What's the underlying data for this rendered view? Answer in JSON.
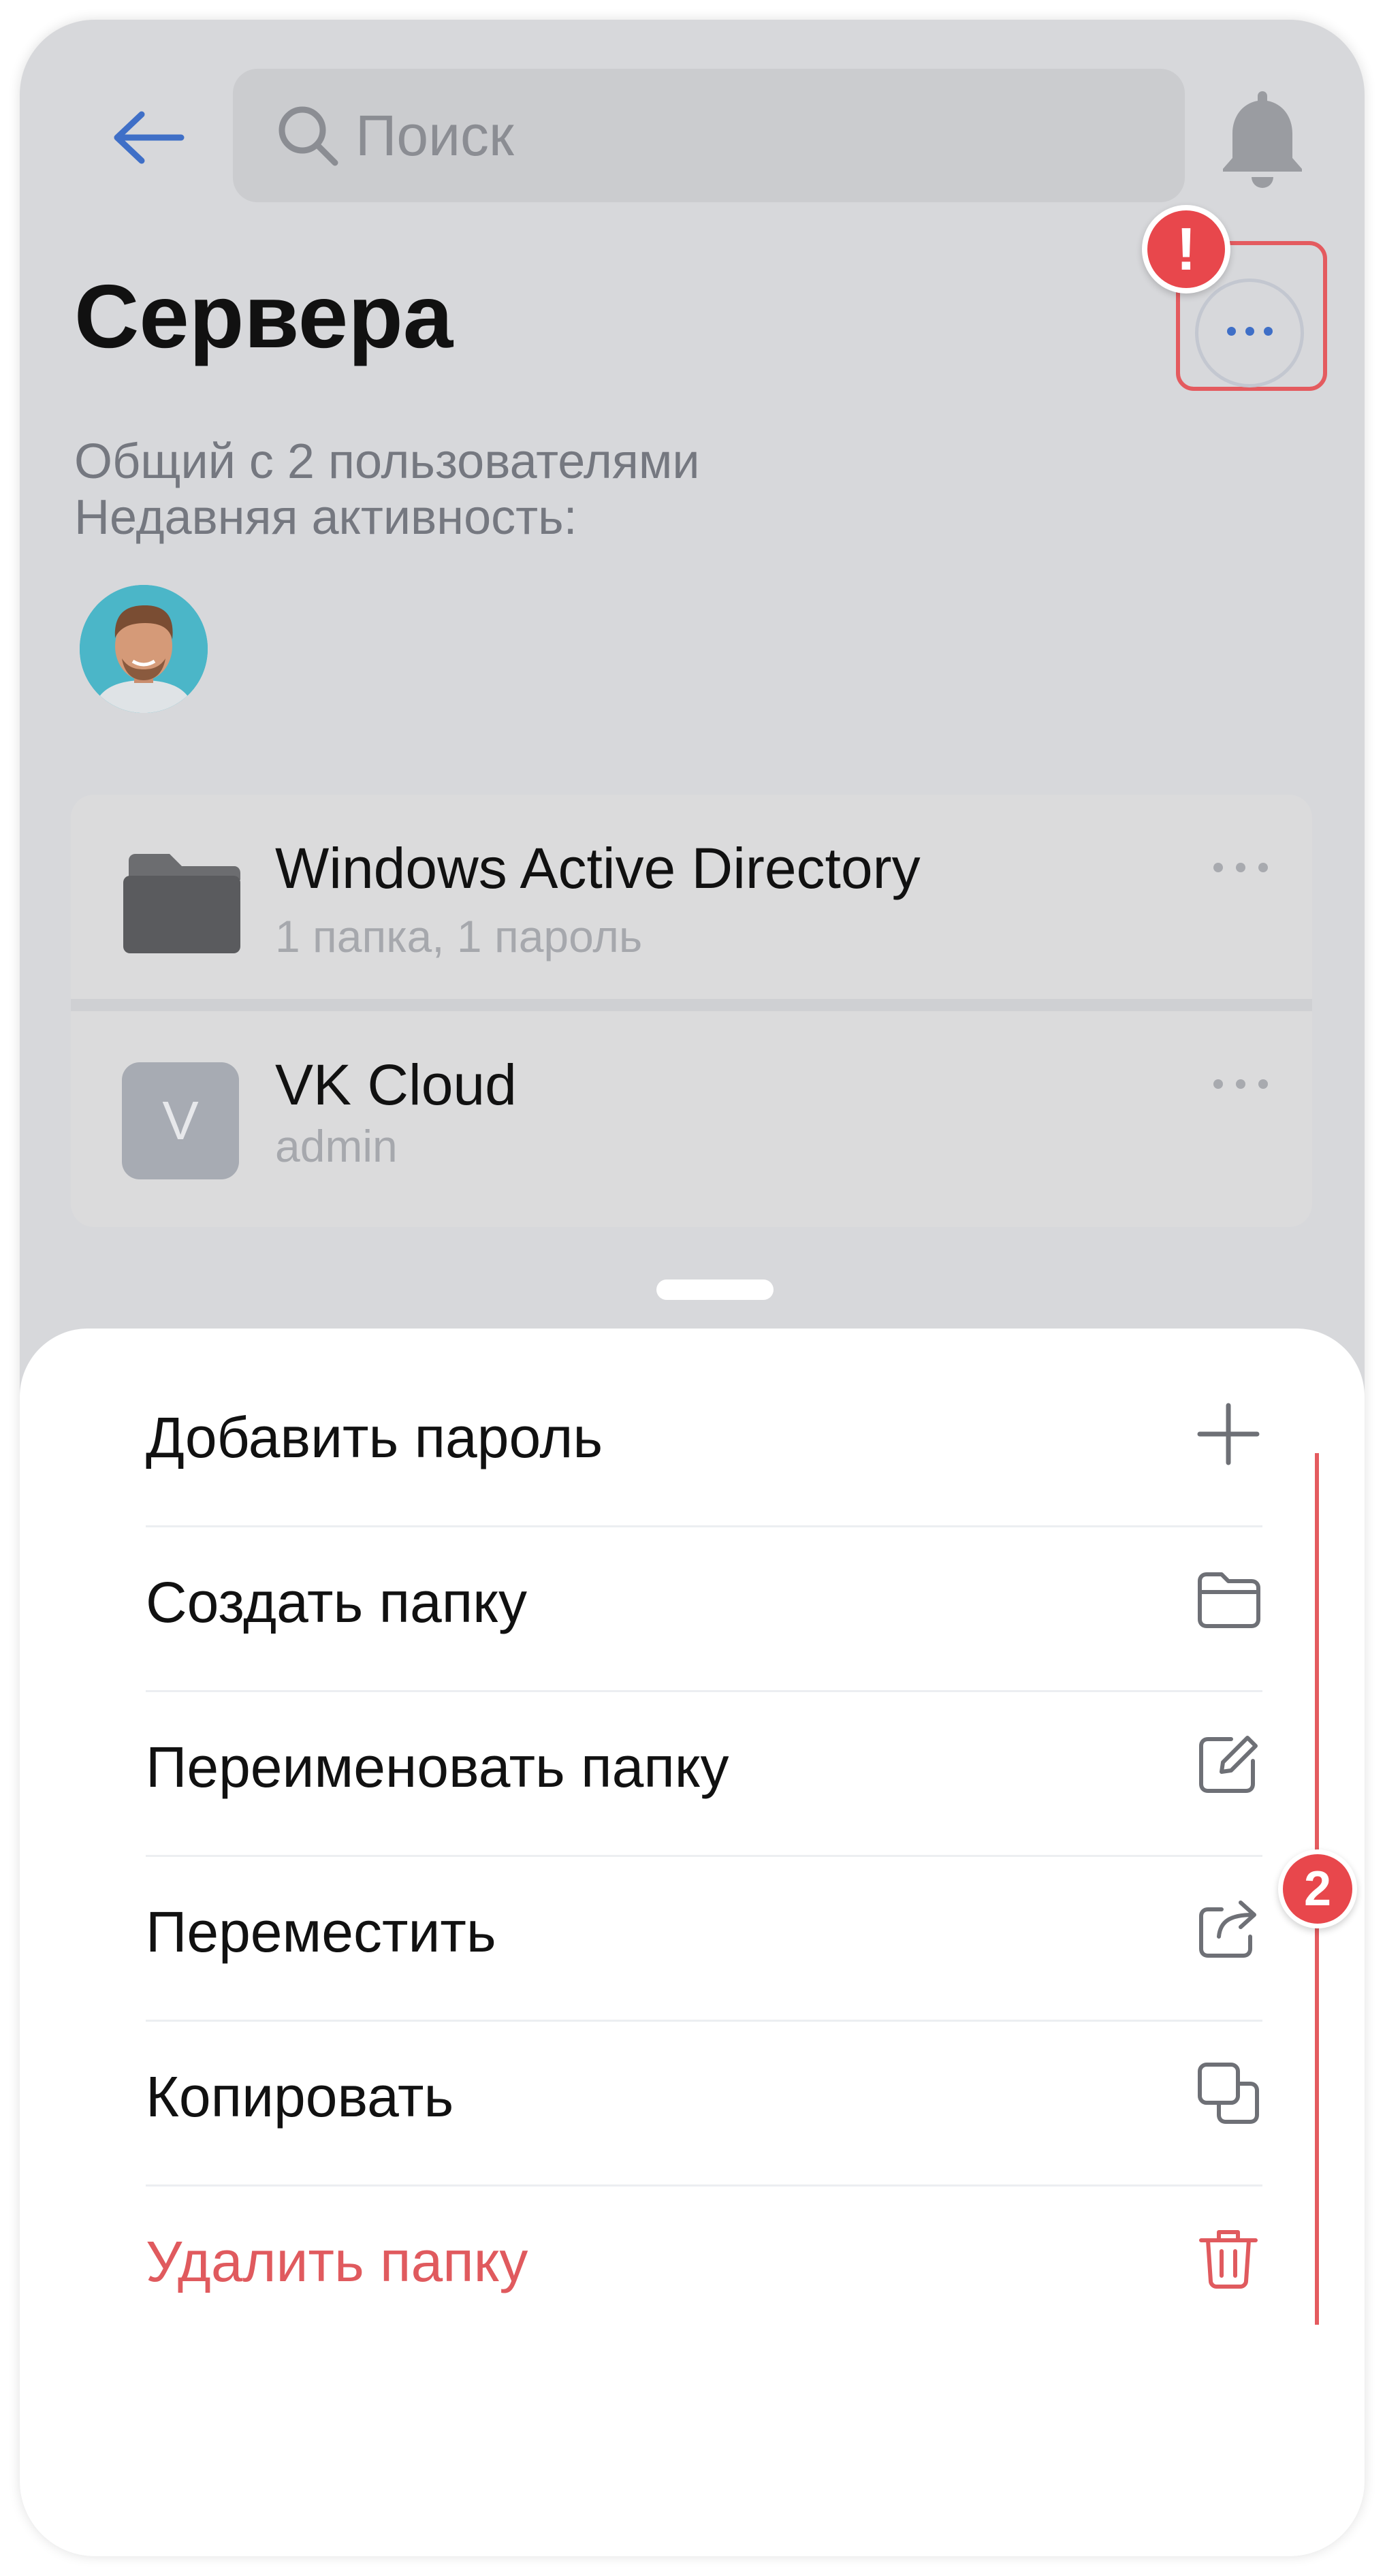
{
  "header": {
    "search_placeholder": "Поиск",
    "back_icon": "arrow-left-icon",
    "notifications_icon": "bell-icon"
  },
  "page": {
    "title": "Сервера",
    "shared_text": "Общий с 2 пользователями",
    "activity_label": "Недавняя активность:"
  },
  "annotations": {
    "badge_warning": "!",
    "badge_step": "2"
  },
  "items": [
    {
      "title": "Windows Active Directory",
      "subtitle": "1 папка, 1 пароль",
      "icon": "folder-icon"
    },
    {
      "title": "VK Cloud",
      "subtitle": "admin",
      "tile_letter": "V"
    }
  ],
  "menu": [
    {
      "label": "Добавить пароль",
      "icon": "plus-icon"
    },
    {
      "label": "Создать папку",
      "icon": "folder-outline-icon"
    },
    {
      "label": "Переименовать папку",
      "icon": "edit-icon"
    },
    {
      "label": "Переместить",
      "icon": "share-icon"
    },
    {
      "label": "Копировать",
      "icon": "copy-icon"
    },
    {
      "label": "Удалить папку",
      "icon": "trash-icon",
      "danger": true
    }
  ],
  "colors": {
    "accent": "#3f6fc7",
    "danger": "#e05a5e",
    "badge": "#e8474c",
    "overlay": "#d7d8db"
  }
}
